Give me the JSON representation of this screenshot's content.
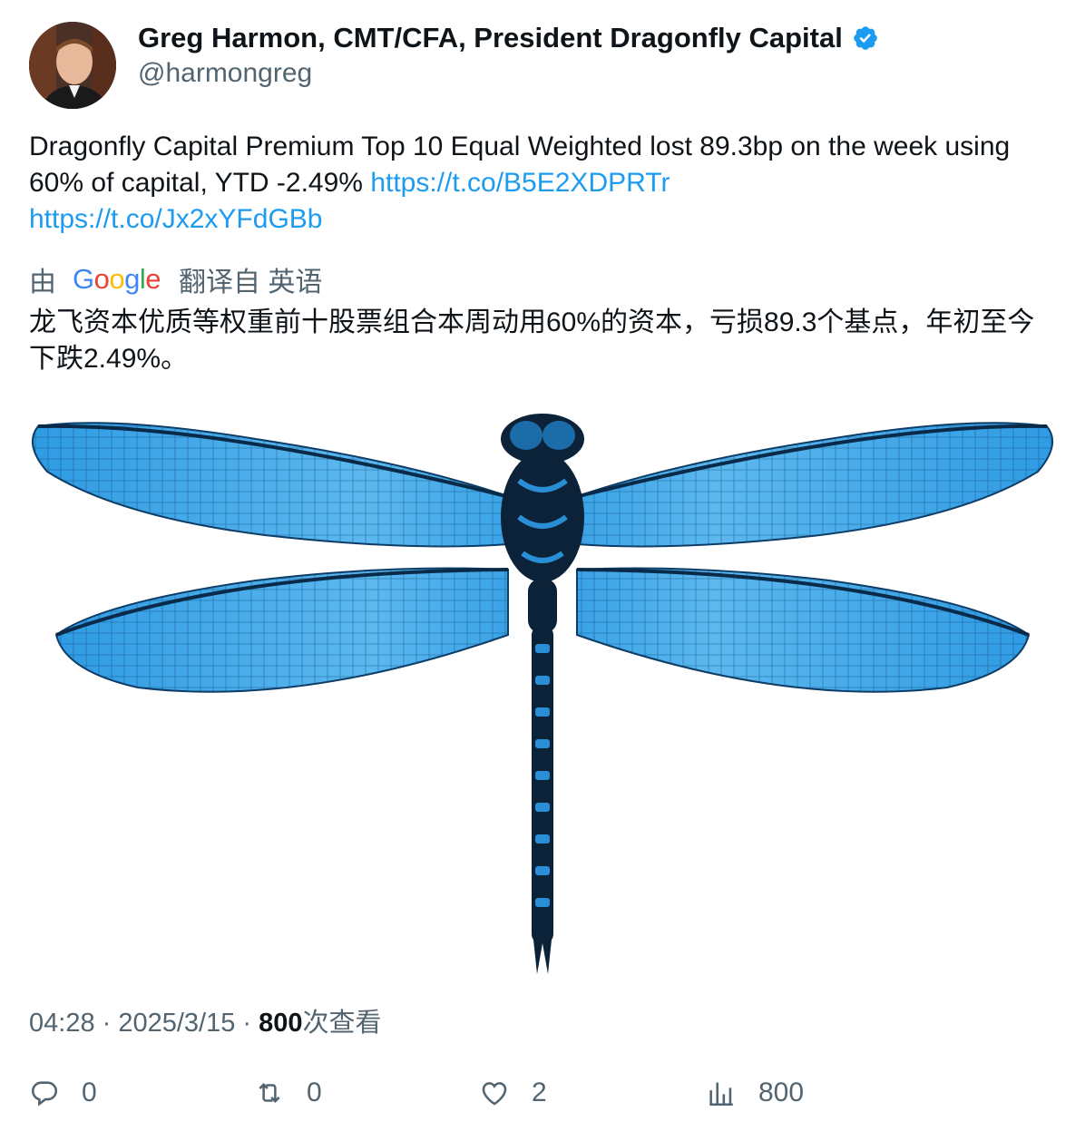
{
  "author": {
    "name": "Greg Harmon, CMT/CFA, President Dragonfly Capital",
    "handle": "@harmongreg",
    "verified_icon": "verified-badge-icon"
  },
  "tweet": {
    "text_main": "Dragonfly Capital Premium Top 10 Equal Weighted lost 89.3bp on the week using 60% of capital,  YTD -2.49% ",
    "link1": "https://t.co/B5E2XDPRTr",
    "link2": "https://t.co/Jx2xYFdGBb"
  },
  "translation": {
    "prefix": "由",
    "google_letters": [
      "G",
      "o",
      "o",
      "g",
      "l",
      "e"
    ],
    "suffix": "翻译自 英语",
    "text": "龙飞资本优质等权重前十股票组合本周动用60%的资本，亏损89.3个基点，年初至今下跌2.49%。"
  },
  "meta": {
    "time": "04:28",
    "separator": " · ",
    "date": "2025/3/15",
    "views_count": "800",
    "views_label": "次查看"
  },
  "actions": {
    "reply_count": "0",
    "retweet_count": "0",
    "like_count": "2",
    "views_count": "800"
  },
  "colors": {
    "link": "#1d9bf0",
    "muted": "#536471",
    "verified": "#1d9bf0",
    "dragonfly_wing": "#3aa3e6",
    "dragonfly_body": "#0c2238"
  }
}
